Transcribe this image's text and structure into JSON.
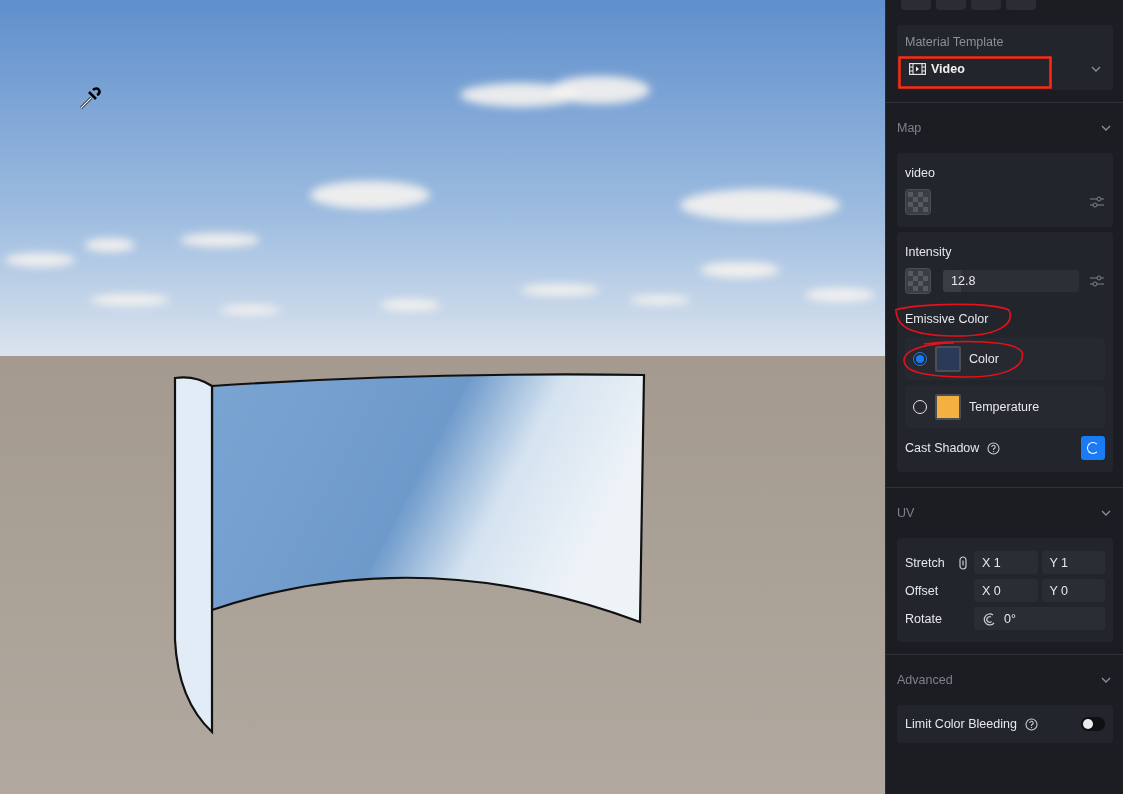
{
  "material_template": {
    "label": "Material Template",
    "value": "Video"
  },
  "map": {
    "title": "Map",
    "video_label": "video",
    "intensity": {
      "label": "Intensity",
      "value": "12.8",
      "level": 0.13
    },
    "emissive_label": "Emissive Color",
    "emissive_options": [
      {
        "label": "Color",
        "selected": true,
        "color": "#2b3b57"
      },
      {
        "label": "Temperature",
        "selected": false,
        "color": "#f5b042"
      }
    ],
    "cast_shadow": {
      "label": "Cast Shadow",
      "on": true
    }
  },
  "uv": {
    "title": "UV",
    "stretch": {
      "label": "Stretch",
      "x": "X 1",
      "y": "Y 1"
    },
    "offset": {
      "label": "Offset",
      "x": "X 0",
      "y": "Y 0"
    },
    "rotate": {
      "label": "Rotate",
      "value": "0°"
    }
  },
  "advanced": {
    "title": "Advanced",
    "limit_color_bleeding": {
      "label": "Limit Color Bleeding",
      "on": false
    }
  }
}
